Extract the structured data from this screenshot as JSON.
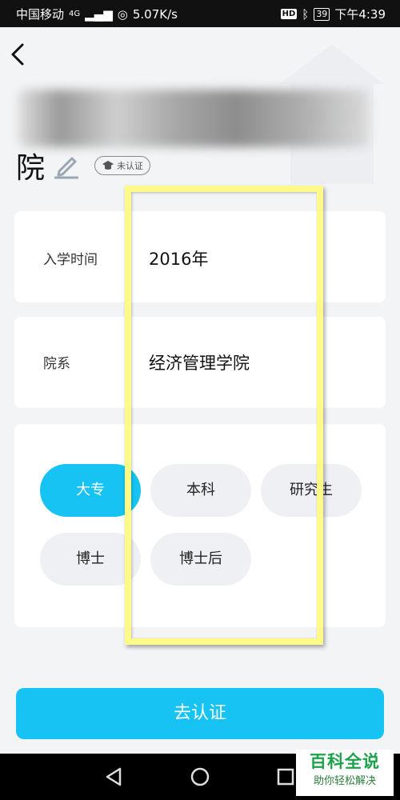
{
  "status_bar": {
    "carrier": "中国移动",
    "network": "4G",
    "speed": "5.07K/s",
    "battery": "39",
    "time": "下午4:39"
  },
  "header": {
    "title_visible": "院",
    "verify_badge": "未认证"
  },
  "form": {
    "year_label": "入学时间",
    "year_value": "2016年",
    "dept_label": "院系",
    "dept_value": "经济管理学院",
    "degrees": [
      {
        "label": "大专",
        "selected": true
      },
      {
        "label": "本科",
        "selected": false
      },
      {
        "label": "研究生",
        "selected": false
      },
      {
        "label": "博士",
        "selected": false
      },
      {
        "label": "博士后",
        "selected": false
      }
    ]
  },
  "submit_label": "去认证",
  "watermark": {
    "main": "百科全说",
    "sub": "助你轻松解决"
  },
  "colors": {
    "accent": "#17c3f2",
    "highlight": "#fdfa8a",
    "background": "#f3f4f6"
  }
}
